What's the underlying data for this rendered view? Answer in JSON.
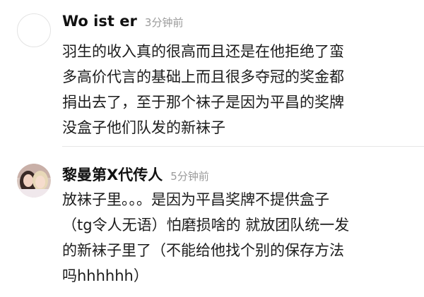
{
  "comments": [
    {
      "username": "Wo ist er",
      "time": "3分钟前",
      "lines": [
        "羽生的收入真的很高而且还是在他拒绝了蛮",
        "多高价代言的基础上而且很多夺冠的奖金都",
        "捐出去了，至于那个袜子是因为平昌的奖牌",
        "没盒子他们队发的新袜子"
      ]
    },
    {
      "username": "黎曼第X代传人",
      "time": "5分钟前",
      "lines": [
        "放袜子里。。。是因为平昌奖牌不提供盒子",
        "（tg令人无语）怕磨损啥的 就放团队统一发",
        "的新袜子里了（不能给他找个别的保存方法",
        "吗hhhhhh）"
      ]
    }
  ]
}
